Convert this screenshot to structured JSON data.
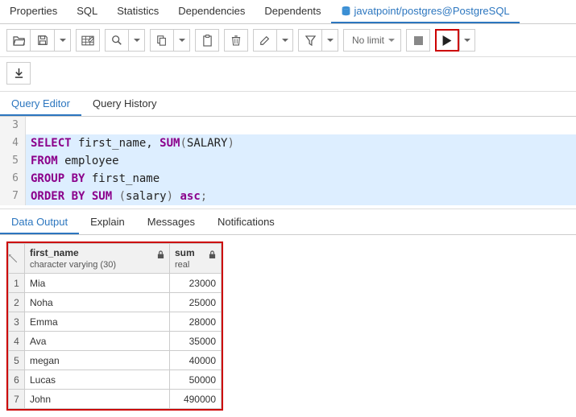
{
  "top_tabs": {
    "properties": "Properties",
    "sql": "SQL",
    "statistics": "Statistics",
    "dependencies": "Dependencies",
    "dependents": "Dependents",
    "connection": "javatpoint/postgres@PostgreSQL"
  },
  "toolbar": {
    "limit": "No limit"
  },
  "query_tabs": {
    "editor": "Query Editor",
    "history": "Query History"
  },
  "code": {
    "line3_num": "3",
    "line4_num": "4",
    "line5_num": "5",
    "line6_num": "6",
    "line7_num": "7",
    "l4_select": "SELECT",
    "l4_firstname": " first_name",
    "l4_comma": ", ",
    "l4_sum": "SUM",
    "l4_open": "(",
    "l4_arg": "SALARY",
    "l4_close": ")",
    "l5_from": "FROM",
    "l5_tbl": " employee",
    "l6_grp": "GROUP BY",
    "l6_col": " first_name",
    "l7_ord": "ORDER BY",
    "l7_sum": "SUM",
    "l7_open": " (",
    "l7_arg": "salary",
    "l7_close": ") ",
    "l7_asc": "asc",
    "l7_semi": ";"
  },
  "result_tabs": {
    "data": "Data Output",
    "explain": "Explain",
    "messages": "Messages",
    "notifications": "Notifications"
  },
  "grid": {
    "col1_name": "first_name",
    "col1_type": "character varying (30)",
    "col2_name": "sum",
    "col2_type": "real",
    "rows": [
      {
        "n": "1",
        "first_name": "Mia",
        "sum": "23000"
      },
      {
        "n": "2",
        "first_name": "Noha",
        "sum": "25000"
      },
      {
        "n": "3",
        "first_name": "Emma",
        "sum": "28000"
      },
      {
        "n": "4",
        "first_name": "Ava",
        "sum": "35000"
      },
      {
        "n": "5",
        "first_name": "megan",
        "sum": "40000"
      },
      {
        "n": "6",
        "first_name": "Lucas",
        "sum": "50000"
      },
      {
        "n": "7",
        "first_name": "John",
        "sum": "490000"
      }
    ]
  }
}
